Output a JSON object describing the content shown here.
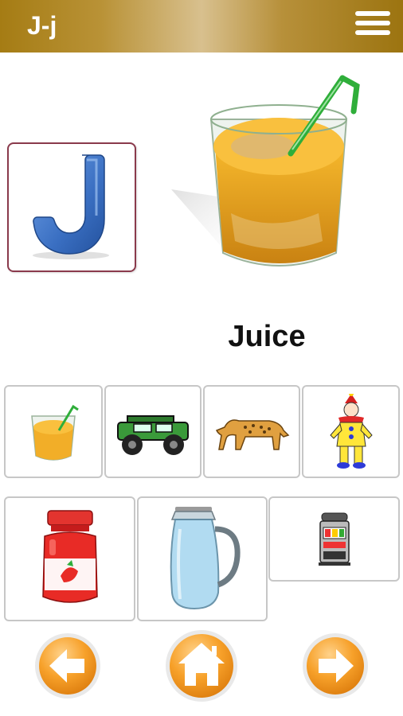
{
  "header": {
    "title": "J-j"
  },
  "letter_card": {
    "letter": "J"
  },
  "main": {
    "word": "Juice"
  },
  "thumbnails": [
    {
      "name": "juice"
    },
    {
      "name": "jeep"
    },
    {
      "name": "jaguar"
    },
    {
      "name": "jester"
    },
    {
      "name": "jam"
    },
    {
      "name": "jug"
    },
    {
      "name": "jackpot"
    }
  ],
  "colors": {
    "header_gold": "#b58b2a",
    "letter_blue": "#3a6fc2",
    "card_border": "#8a3a4c",
    "nav_orange": "#f39a1c"
  },
  "icons": {
    "menu": "hamburger-icon",
    "prev": "arrow-left-icon",
    "home": "home-icon",
    "next": "arrow-right-icon"
  }
}
